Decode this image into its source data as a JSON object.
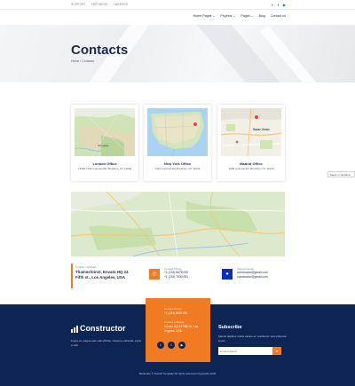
{
  "topbar": {
    "links": [
      "SUPPORT",
      "PARTNERS",
      "CAREERS"
    ],
    "social_icons": [
      "twitter-icon",
      "facebook-icon",
      "youtube-icon"
    ],
    "social_glyphs": [
      "t",
      "f",
      "▶"
    ]
  },
  "nav": {
    "items": [
      "Home Pages ⌄",
      "Projects ⌄",
      "Pages ⌄",
      "Blog",
      "Contact us"
    ]
  },
  "hero": {
    "title": "Contacts",
    "breadcrumb": "Home / Contacts"
  },
  "offices": [
    {
      "name": "London Office",
      "address": "73481 7299 Colonial Rd, Brooklyn, NY 11209"
    },
    {
      "name": "New York Office",
      "address": "7301 Colonial Rd, Brooklyn, NY 11209"
    },
    {
      "name": "Madrid Office",
      "address": "7298 Colonial Rd, Brooklyn, NY 11209"
    }
  ],
  "map_labels": {
    "london_label": "Mongolia",
    "madrid_label": "Sasar Union"
  },
  "made_in_badge": "Made in Webflow",
  "contact": {
    "address_label": "Contact / Address",
    "address": "Thamesfoinst, Envato HQ 24 Fifth st., Los Angeles, USA",
    "phone_label": "Contact Phone",
    "phones": [
      "+1 (234) 5678 090",
      "+1 (234) 7630 054"
    ],
    "email_label": "Support Email",
    "emails": [
      "constructor@gmail.com",
      "constructor@gmail.com"
    ]
  },
  "footer": {
    "brand": "Constructor",
    "description": "Fusce eu magna quis velit efficitur. Vivamus vehicula, turpis a velit",
    "orange": {
      "phone_label": "Contact Phone",
      "phone": "+1 (234) 5678 090",
      "address_label": "Contact Address",
      "address": "Envato HQ 24 Fifth st., Los Angeles, USA"
    },
    "subscribe_title": "Subscribe",
    "subscribe_desc": "Mauris dapibus mattis sapien ac vestibulum quis pharetra ipsum.",
    "email_placeholder": "Email Address",
    "copyright": "Martindoc © Dustrix Template All rights reserved Copyrights 2020"
  },
  "colors": {
    "accent": "#f07b22",
    "navy": "#0e2452",
    "blue": "#0b2dbe",
    "text_dark": "#1d2a4d"
  }
}
